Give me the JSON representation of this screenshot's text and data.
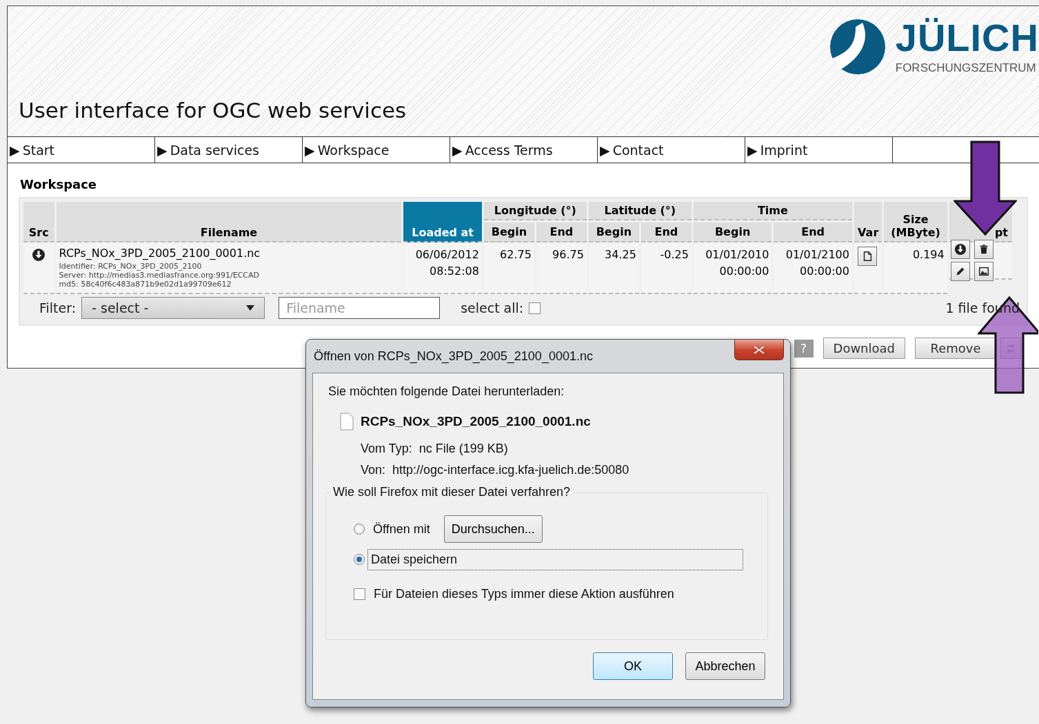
{
  "header": {
    "title": "User interface for OGC web services",
    "logo": {
      "name": "JÜLICH",
      "sub": "FORSCHUNGSZENTRUM"
    }
  },
  "nav": [
    {
      "marker": "▶",
      "label": "Start"
    },
    {
      "marker": "▶",
      "label": "Data services"
    },
    {
      "marker": "▶",
      "label": "Workspace"
    },
    {
      "marker": "▶",
      "label": "Access Terms"
    },
    {
      "marker": "▶",
      "label": "Contact"
    },
    {
      "marker": "▶",
      "label": "Imprint"
    }
  ],
  "workspace": {
    "heading": "Workspace",
    "table": {
      "columns": [
        {
          "label": "Src",
          "sorted": false
        },
        {
          "label": "Filename",
          "sorted": false
        },
        {
          "label": "Loaded at",
          "sorted": true
        },
        {
          "label": "Longitude (°)",
          "sub": [
            "Begin",
            "End"
          ],
          "sorted": false
        },
        {
          "label": "Latitude (°)",
          "sub": [
            "Begin",
            "End"
          ],
          "sorted": false
        },
        {
          "label": "Time",
          "sub": [
            "Begin",
            "End"
          ],
          "sorted": false
        },
        {
          "label": "Var",
          "sorted": false
        },
        {
          "label": "Size (MByte)",
          "sorted": false
        },
        {
          "label": "pt",
          "sorted": false
        }
      ],
      "rows": [
        {
          "filename": "RCPs_NOx_3PD_2005_2100_0001.nc",
          "details": [
            "Identifier: RCPs_NOx_3PD_2005_2100",
            "Server: http://medias3.mediasfrance.org:991/ECCAD",
            "md5: 58c40f6c483a871b9e02d1a99709e612"
          ],
          "loaded": [
            "06/06/2012",
            "08:52:08"
          ],
          "values": [
            [
              "62.75"
            ],
            [
              "96.75"
            ],
            [
              "34.25"
            ],
            [
              "-0.25"
            ],
            [
              "01/01/2010",
              "00:00:00"
            ],
            [
              "01/01/2100",
              "00:00:00"
            ]
          ],
          "size": "0.194"
        }
      ]
    },
    "filter": {
      "label": "Filter:",
      "select": "- select -",
      "placeholder": "Filename",
      "select_all": "select all:",
      "select_all_checked": false,
      "count": "1 file found"
    },
    "buttons": [
      {
        "kind": "help",
        "label": "?"
      },
      {
        "kind": "text",
        "label": "Download"
      },
      {
        "kind": "text",
        "label": "Remove"
      },
      {
        "kind": "refresh"
      }
    ]
  },
  "dialog": {
    "title": "Öffnen von RCPs_NOx_3PD_2005_2100_0001.nc",
    "intro": "Sie möchten folgende Datei herunterladen:",
    "filename": "RCPs_NOx_3PD_2005_2100_0001.nc",
    "type_label": "Vom Typ:",
    "type_value": "nc File (199 KB)",
    "from_label": "Von:",
    "from_value": "http://ogc-interface.icg.kfa-juelich.de:50080",
    "question": "Wie soll Firefox mit dieser Datei verfahren?",
    "options": [
      {
        "kind": "radio",
        "label": "Öffnen mit",
        "selected": false,
        "button": "Durchsuchen..."
      },
      {
        "kind": "radio",
        "label": "Datei speichern",
        "selected": true
      },
      {
        "kind": "checkbox",
        "label": "Für Dateien dieses Typs immer diese Aktion ausführen",
        "checked": false
      }
    ],
    "buttons": [
      {
        "label": "OK",
        "default": true
      },
      {
        "label": "Abbrechen",
        "default": false
      }
    ]
  }
}
